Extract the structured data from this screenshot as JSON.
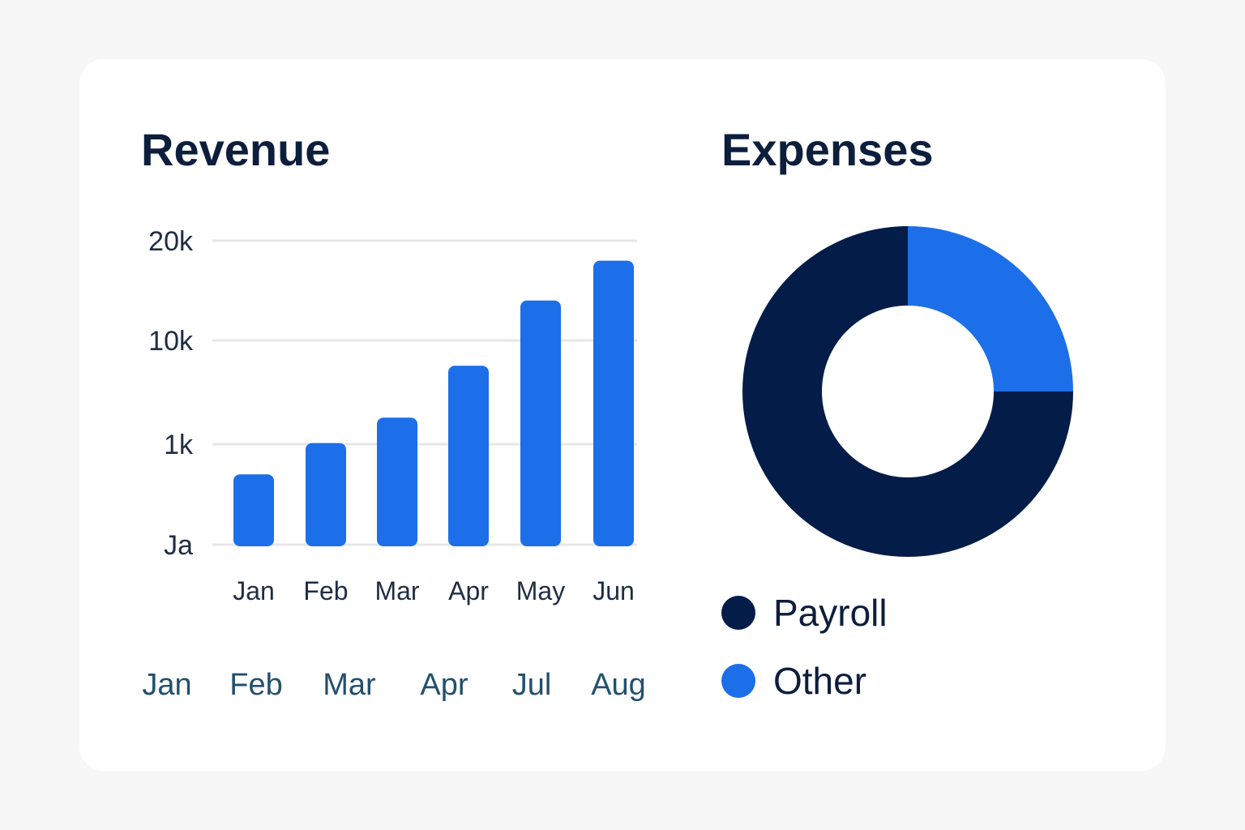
{
  "colors": {
    "bar": "#1c6fe8",
    "payroll": "#041c48",
    "other": "#1c6fe8",
    "grid": "#e6e7ea"
  },
  "chart_data": [
    {
      "type": "bar",
      "title": "Revenue",
      "y_tick_labels": [
        "Ja",
        "1k",
        "10k",
        "20k"
      ],
      "categories": [
        "Jan",
        "Feb",
        "Mar",
        "Apr",
        "May",
        "Jun"
      ],
      "secondary_x_labels": [
        "Jan",
        "Feb",
        "Mar",
        "Apr",
        "Jul",
        "Aug"
      ],
      "values": [
        700,
        1100,
        3300,
        7800,
        14000,
        18000
      ],
      "grid": true
    },
    {
      "type": "pie",
      "title": "Expenses",
      "labels": [
        "Payroll",
        "Other"
      ],
      "values": [
        75,
        25
      ],
      "donut": true,
      "legend": "bottom"
    }
  ]
}
